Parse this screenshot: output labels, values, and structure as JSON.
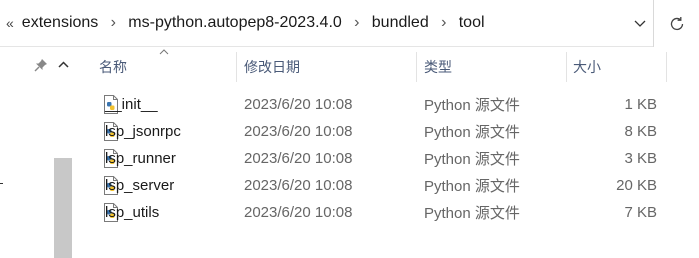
{
  "address_bar": {
    "overflow": "«",
    "breadcrumbs": [
      "extensions",
      "ms-python.autopep8-2023.4.0",
      "bundled",
      "tool"
    ],
    "separator": "›"
  },
  "columns": {
    "name": "名称",
    "date": "修改日期",
    "type": "类型",
    "size": "大小"
  },
  "files": [
    {
      "name": "__init__",
      "date": "2023/6/20 10:08",
      "type": "Python 源文件",
      "size": "1 KB"
    },
    {
      "name": "lsp_jsonrpc",
      "date": "2023/6/20 10:08",
      "type": "Python 源文件",
      "size": "8 KB"
    },
    {
      "name": "lsp_runner",
      "date": "2023/6/20 10:08",
      "type": "Python 源文件",
      "size": "3 KB"
    },
    {
      "name": "lsp_server",
      "date": "2023/6/20 10:08",
      "type": "Python 源文件",
      "size": "20 KB"
    },
    {
      "name": "lsp_utils",
      "date": "2023/6/20 10:08",
      "type": "Python 源文件",
      "size": "7 KB"
    }
  ],
  "icons": {
    "file": "python-file-icon",
    "pin": "pin-icon",
    "refresh": "refresh-icon",
    "dropdown": "chevron-down-icon",
    "sort": "sort-ascending-icon"
  }
}
